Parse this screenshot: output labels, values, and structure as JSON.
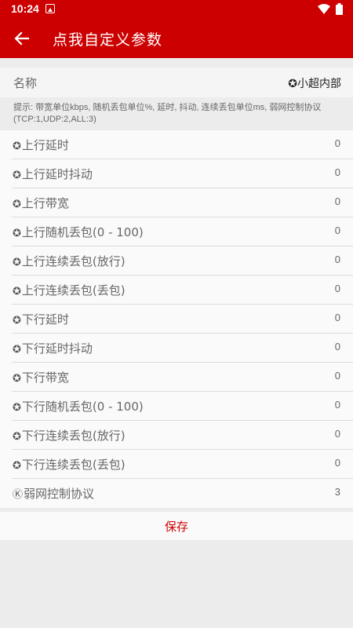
{
  "status_bar": {
    "time": "10:24",
    "icons": [
      "app-notification-icon",
      "wifi-icon",
      "battery-icon"
    ]
  },
  "app_bar": {
    "title": "点我自定义参数",
    "back_icon": "arrow-left-icon"
  },
  "name_row": {
    "label": "名称",
    "value": "✪小超内部"
  },
  "hint": "提示: 带宽单位kbps, 随机丢包单位%, 延时, 抖动, 连续丢包单位ms, 弱网控制协议(TCP:1,UDP:2,ALL:3)",
  "params": [
    {
      "icon": "✪",
      "label": "上行延时",
      "value": "0"
    },
    {
      "icon": "✪",
      "label": "上行延时抖动",
      "value": "0"
    },
    {
      "icon": "✪",
      "label": "上行带宽",
      "value": "0"
    },
    {
      "icon": "✪",
      "label": "上行随机丢包(0 - 100)",
      "value": "0"
    },
    {
      "icon": "✪",
      "label": "上行连续丢包(放行)",
      "value": "0"
    },
    {
      "icon": "✪",
      "label": "上行连续丢包(丢包)",
      "value": "0"
    },
    {
      "icon": "✪",
      "label": "下行延时",
      "value": "0"
    },
    {
      "icon": "✪",
      "label": "下行延时抖动",
      "value": "0"
    },
    {
      "icon": "✪",
      "label": "下行带宽",
      "value": "0"
    },
    {
      "icon": "✪",
      "label": "下行随机丢包(0 - 100)",
      "value": "0"
    },
    {
      "icon": "✪",
      "label": "下行连续丢包(放行)",
      "value": "0"
    },
    {
      "icon": "✪",
      "label": "下行连续丢包(丢包)",
      "value": "0"
    },
    {
      "icon": "Ⓚ",
      "label": "弱网控制协议",
      "value": "3"
    }
  ],
  "save_label": "保存",
  "colors": {
    "primary": "#cc0000",
    "background": "#ececec",
    "row_background": "#fafafa",
    "text_secondary": "#666666"
  }
}
